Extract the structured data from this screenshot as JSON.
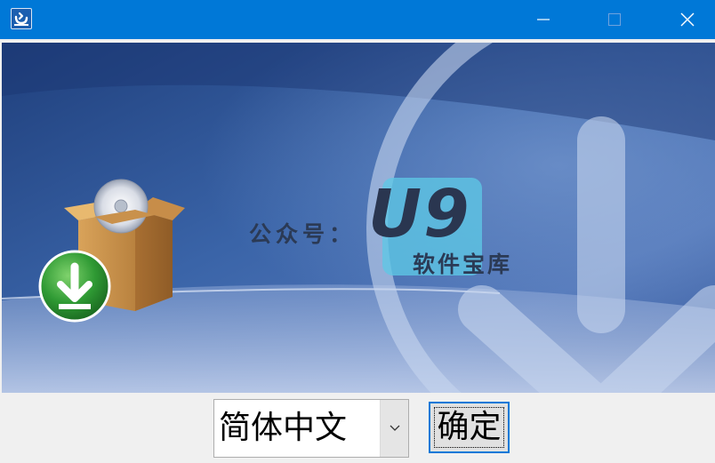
{
  "titlebar": {
    "app_icon": "installer-app-icon",
    "controls": {
      "minimize_icon": "minimize-icon",
      "maximize_icon": "maximize-icon",
      "close_icon": "close-icon"
    },
    "color": "#0078d7"
  },
  "banner": {
    "background_color": "#2e5596",
    "watermark_prefix": "公众号：",
    "watermark_logo": "U9",
    "watermark_sub": "软件宝库",
    "logo_badge_color": "#5dc8e6",
    "illustration": "software-box-with-disc",
    "install_badge_icon": "green-download-icon",
    "big_arrow_icon": "download-arrow-circle-icon"
  },
  "controls": {
    "language_select": {
      "value": "简体中文",
      "dropdown_icon": "chevron-down-icon"
    },
    "confirm_button": {
      "label": "确定",
      "focus_color": "#0078d7"
    }
  }
}
